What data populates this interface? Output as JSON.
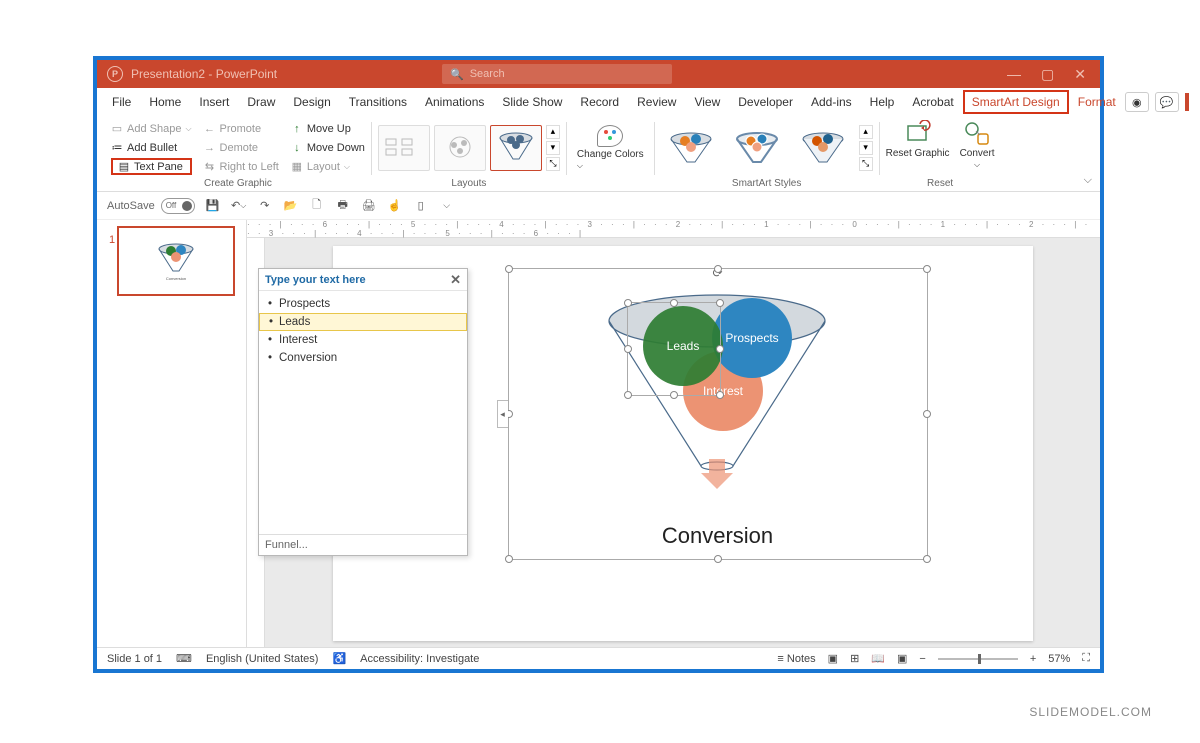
{
  "app": {
    "title": "Presentation2 - PowerPoint"
  },
  "search": {
    "placeholder": "Search"
  },
  "window": {
    "min": "—",
    "max": "▢",
    "close": "✕"
  },
  "tabs": {
    "file": "File",
    "home": "Home",
    "insert": "Insert",
    "draw": "Draw",
    "design": "Design",
    "transitions": "Transitions",
    "animations": "Animations",
    "slideshow": "Slide Show",
    "record": "Record",
    "review": "Review",
    "view": "View",
    "developer": "Developer",
    "addins": "Add-ins",
    "help": "Help",
    "acrobat": "Acrobat",
    "smartart_design": "SmartArt Design",
    "format": "Format"
  },
  "ribbon": {
    "add_shape": "Add Shape",
    "add_bullet": "Add Bullet",
    "text_pane": "Text Pane",
    "promote": "Promote",
    "demote": "Demote",
    "right_to_left": "Right to Left",
    "move_up": "Move Up",
    "move_down": "Move Down",
    "layout": "Layout",
    "create_graphic": "Create Graphic",
    "layouts": "Layouts",
    "change_colors": "Change Colors",
    "smartart_styles": "SmartArt Styles",
    "reset_graphic": "Reset Graphic",
    "convert": "Convert",
    "reset": "Reset"
  },
  "qat": {
    "autosave": "AutoSave",
    "off": "Off"
  },
  "textpane": {
    "header": "Type your text here",
    "items": [
      "Prospects",
      "Leads",
      "Interest",
      "Conversion"
    ],
    "selected_index": 1,
    "footer": "Funnel..."
  },
  "smartart": {
    "circle1": "Leads",
    "circle2": "Prospects",
    "circle3": "Interest",
    "conversion": "Conversion"
  },
  "thumb": {
    "number": "1"
  },
  "status": {
    "slide": "Slide 1 of 1",
    "lang": "English (United States)",
    "accessibility": "Accessibility: Investigate",
    "notes": "Notes",
    "zoom": "57%"
  },
  "ruler": "· · · | · · · 6 · · · | · · · 5 · · · | · · · 4 · · · | · · · 3 · · · | · · · 2 · · · | · · · 1 · · · | · · · 0 · · · | · · · 1 · · · | · · · 2 · · · | · · · 3 · · · | · · · 4 · · · | · · · 5 · · · | · · · 6 · · · |",
  "watermark": "SLIDEMODEL.COM"
}
